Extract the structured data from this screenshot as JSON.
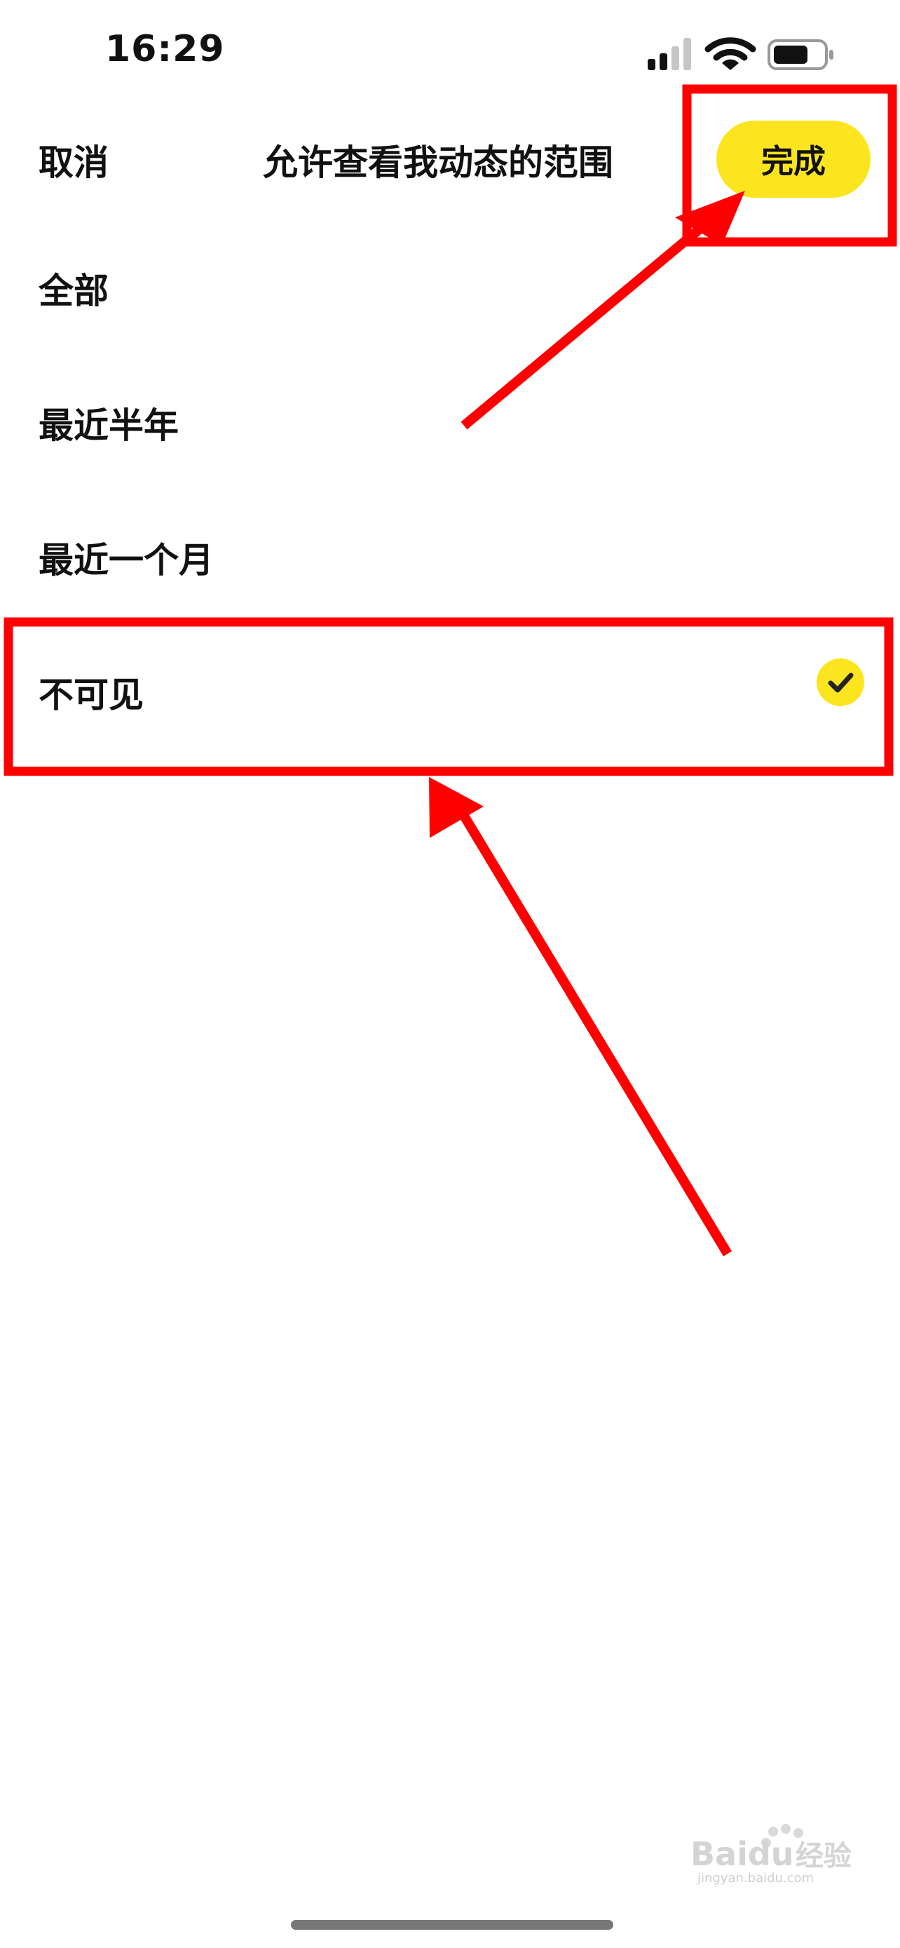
{
  "status_bar": {
    "time": "16:29",
    "icons": [
      "cellular-signal-icon",
      "wifi-icon",
      "battery-icon"
    ]
  },
  "header": {
    "cancel_label": "取消",
    "title": "允许查看我动态的范围",
    "done_label": "完成"
  },
  "options": [
    {
      "label": "全部",
      "selected": false
    },
    {
      "label": "最近半年",
      "selected": false
    },
    {
      "label": "最近一个月",
      "selected": false
    },
    {
      "label": "不可见",
      "selected": true
    }
  ],
  "colors": {
    "accent_yellow": "#fce51e",
    "annotation_red": "#ff0000",
    "text": "#111111",
    "background": "#ffffff"
  },
  "watermark": {
    "brand": "Baidu",
    "text": "经验",
    "url": "jingyan.baidu.com"
  }
}
